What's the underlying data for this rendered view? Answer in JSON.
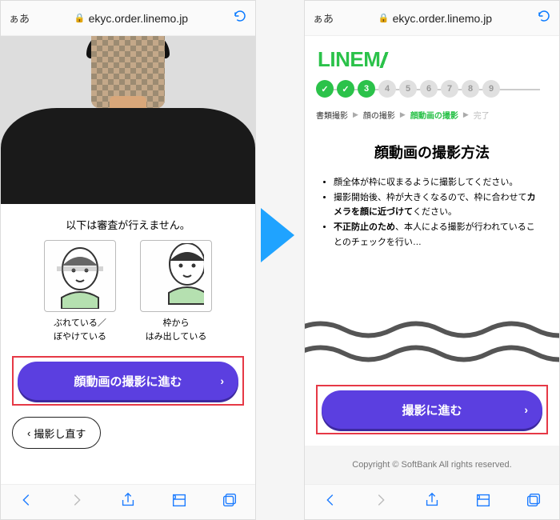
{
  "browser": {
    "aa": "ぁあ",
    "url": "ekyc.order.linemo.jp"
  },
  "left": {
    "warning": "以下は審査が行えません。",
    "example1": "ぶれている／\nぼやけている",
    "example2": "枠から\nはみ出している",
    "cta": "顔動画の撮影に進む",
    "retake": "撮影し直す"
  },
  "right": {
    "brand": "LINEM",
    "steps": {
      "done": [
        1,
        2
      ],
      "current": 3,
      "todo": [
        4,
        5,
        6,
        7,
        8,
        9
      ]
    },
    "crumbs": {
      "c1": "書類撮影",
      "c2": "顔の撮影",
      "c3": "顔動画の撮影",
      "c4": "完了"
    },
    "title": "顔動画の撮影方法",
    "bullet1": "顔全体が枠に収まるように撮影してください。",
    "bullet2_a": "撮影開始後、枠が大きくなるので、枠に合わせて",
    "bullet2_b": "カメラを顔に近づけて",
    "bullet2_c": "ください。",
    "bullet3_a": "不正防止のため",
    "bullet3_b": "、本人による撮影が行われていることのチェックを行い…",
    "cta": "撮影に進む",
    "copyright": "Copyright © SoftBank All rights reserved."
  }
}
